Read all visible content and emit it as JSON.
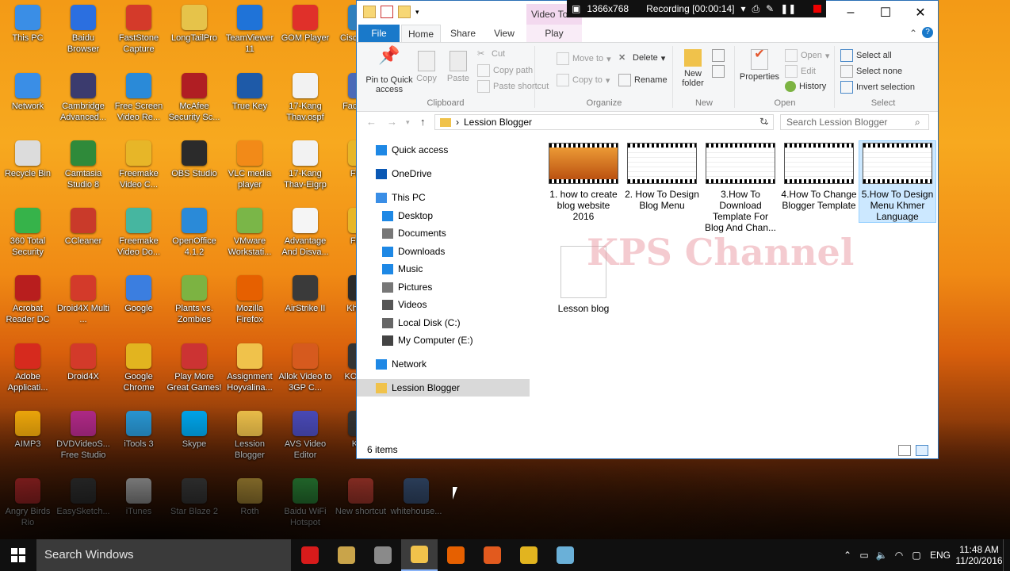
{
  "desktop": {
    "icons": [
      {
        "label": "This PC",
        "icon": "this-pc-icon",
        "color": "#3a8ee6"
      },
      {
        "label": "Baidu Browser",
        "icon": "baidu-browser-icon",
        "color": "#2b6fe0"
      },
      {
        "label": "FastStone Capture",
        "icon": "faststone-icon",
        "color": "#d43a2a"
      },
      {
        "label": "LongTailPro",
        "icon": "longtailpro-icon",
        "color": "#e6c34a"
      },
      {
        "label": "TeamViewer 11",
        "icon": "teamviewer-icon",
        "color": "#1f73d8"
      },
      {
        "label": "GOM Player",
        "icon": "gom-player-icon",
        "color": "#e0302a"
      },
      {
        "label": "Cisco Trac",
        "icon": "cisco-icon",
        "color": "#2f7fbd"
      },
      {
        "label": "Network",
        "icon": "network-icon",
        "color": "#3a8ee6"
      },
      {
        "label": "Cambridge Advanced...",
        "icon": "cambridge-icon",
        "color": "#3b3b6e"
      },
      {
        "label": "Free Screen Video Re...",
        "icon": "free-screen-icon",
        "color": "#2a8ad8"
      },
      {
        "label": "McAfee Security Sc...",
        "icon": "mcafee-icon",
        "color": "#b01e23"
      },
      {
        "label": "True Key",
        "icon": "true-key-icon",
        "color": "#1e5aa8"
      },
      {
        "label": "17-Kang Thav.ospf",
        "icon": "ospf-file-icon",
        "color": "#f2f2f2"
      },
      {
        "label": "Face Gar",
        "icon": "face-icon",
        "color": "#4a6ab8"
      },
      {
        "label": "Recycle Bin",
        "icon": "recycle-bin-icon",
        "color": "#dcdcdc"
      },
      {
        "label": "Camtasia Studio 8",
        "icon": "camtasia-icon",
        "color": "#2f8a3a"
      },
      {
        "label": "Freemake Video C...",
        "icon": "freemake-icon",
        "color": "#e7b628"
      },
      {
        "label": "OBS Studio",
        "icon": "obs-icon",
        "color": "#2b2b2b"
      },
      {
        "label": "VLC media player",
        "icon": "vlc-icon",
        "color": "#f28a18"
      },
      {
        "label": "17-Kang Thav-Eigrp",
        "icon": "eigrp-file-icon",
        "color": "#f2f2f2"
      },
      {
        "label": "Freer",
        "icon": "freer-icon",
        "color": "#e7b628"
      },
      {
        "label": "360 Total Security",
        "icon": "360-security-icon",
        "color": "#36b34a"
      },
      {
        "label": "CCleaner",
        "icon": "ccleaner-icon",
        "color": "#c93a2a"
      },
      {
        "label": "Freemake Video Do...",
        "icon": "freemake-download-icon",
        "color": "#46b6a0"
      },
      {
        "label": "OpenOffice 4.1.2",
        "icon": "openoffice-icon",
        "color": "#2a8ad8"
      },
      {
        "label": "VMware Workstati...",
        "icon": "vmware-icon",
        "color": "#7ab648"
      },
      {
        "label": "Advantage And Disva...",
        "icon": "document-icon",
        "color": "#f5f5f5"
      },
      {
        "label": "Freer",
        "icon": "freer2-icon",
        "color": "#e7b628"
      },
      {
        "label": "Acrobat Reader DC",
        "icon": "acrobat-icon",
        "color": "#b81e1e"
      },
      {
        "label": "Droid4X Multi ...",
        "icon": "droid4x-multi-icon",
        "color": "#d33a2a"
      },
      {
        "label": "Google",
        "icon": "google-icon",
        "color": "#3b7ee0"
      },
      {
        "label": "Plants vs. Zombies",
        "icon": "pvz-icon",
        "color": "#7cb342"
      },
      {
        "label": "Mozilla Firefox",
        "icon": "firefox-icon",
        "color": "#e66000"
      },
      {
        "label": "AirStrike II",
        "icon": "airstrike-icon",
        "color": "#3a3a3a"
      },
      {
        "label": "Kh Key",
        "icon": "khkey-icon",
        "color": "#2a2a2a"
      },
      {
        "label": "Adobe Applicati...",
        "icon": "adobe-icon",
        "color": "#d62a1e"
      },
      {
        "label": "Droid4X",
        "icon": "droid4x-icon",
        "color": "#d33a2a"
      },
      {
        "label": "Google Chrome",
        "icon": "chrome-icon",
        "color": "#e2b41f"
      },
      {
        "label": "Play More Great Games!",
        "icon": "popcap-icon",
        "color": "#c33"
      },
      {
        "label": "Assignment Hoyvalina...",
        "icon": "folder-icon",
        "color": "#f0c24b"
      },
      {
        "label": "Allok Video to 3GP C...",
        "icon": "allok-icon",
        "color": "#d65a1e"
      },
      {
        "label": "KOF Mu",
        "icon": "kof-icon",
        "color": "#333"
      },
      {
        "label": "AIMP3",
        "icon": "aimp-icon",
        "color": "#f1a90b"
      },
      {
        "label": "DVDVideoS... Free Studio",
        "icon": "dvdvideosoft-icon",
        "color": "#b42a8a"
      },
      {
        "label": "iTools 3",
        "icon": "itools-icon",
        "color": "#2a9ad8"
      },
      {
        "label": "Skype",
        "icon": "skype-icon",
        "color": "#00a9f0"
      },
      {
        "label": "Lession Blogger",
        "icon": "folder-icon",
        "color": "#f0c24b"
      },
      {
        "label": "AVS Video Editor",
        "icon": "avs-icon",
        "color": "#4a4ab8"
      },
      {
        "label": "KOF",
        "icon": "kof2-icon",
        "color": "#333"
      },
      {
        "label": "Angry Birds Rio",
        "icon": "angry-birds-icon",
        "color": "#d33"
      },
      {
        "label": "EasySketch...",
        "icon": "easysketch-icon",
        "color": "#444"
      },
      {
        "label": "iTunes",
        "icon": "itunes-icon",
        "color": "#eaeaea"
      },
      {
        "label": "Star Blaze 2",
        "icon": "starblaze-icon",
        "color": "#555"
      },
      {
        "label": "Roth",
        "icon": "folder-icon",
        "color": "#f0c24b"
      },
      {
        "label": "Baidu WiFi Hotspot",
        "icon": "baidu-wifi-icon",
        "color": "#3ab34a"
      },
      {
        "label": "New shortcut",
        "icon": "windows-shortcut-icon",
        "color": "#e74c3c"
      },
      {
        "label": "whitehouse...",
        "icon": "whitehouse-icon",
        "color": "#4a6a9a"
      }
    ]
  },
  "explorer": {
    "context_tab": "Video To",
    "recorder": {
      "resolution": "1366x768",
      "status": "Recording [00:00:14]"
    },
    "tabs": {
      "file": "File",
      "home": "Home",
      "share": "Share",
      "view": "View",
      "play": "Play"
    },
    "ribbon": {
      "clipboard": {
        "pin": "Pin to Quick access",
        "copy": "Copy",
        "paste": "Paste",
        "cut": "Cut",
        "copy_path": "Copy path",
        "paste_shortcut": "Paste shortcut",
        "group": "Clipboard"
      },
      "organize": {
        "move_to": "Move to",
        "copy_to": "Copy to",
        "delete": "Delete",
        "rename": "Rename",
        "group": "Organize"
      },
      "new": {
        "new_folder": "New folder",
        "group": "New"
      },
      "open": {
        "properties": "Properties",
        "open": "Open",
        "edit": "Edit",
        "history": "History",
        "group": "Open"
      },
      "select": {
        "select_all": "Select all",
        "select_none": "Select none",
        "invert": "Invert selection",
        "group": "Select"
      }
    },
    "address": {
      "path": "Lession Blogger",
      "search_placeholder": "Search Lession Blogger"
    },
    "nav": [
      {
        "label": "Quick access",
        "icon": "star-icon",
        "color": "#1e88e5"
      },
      {
        "label": "OneDrive",
        "icon": "onedrive-icon",
        "color": "#0a58b4"
      },
      {
        "label": "This PC",
        "icon": "this-pc-icon",
        "color": "#3a8ee6"
      },
      {
        "label": "Desktop",
        "icon": "desktop-icon",
        "color": "#1e88e5"
      },
      {
        "label": "Documents",
        "icon": "documents-icon",
        "color": "#777"
      },
      {
        "label": "Downloads",
        "icon": "downloads-icon",
        "color": "#1e88e5"
      },
      {
        "label": "Music",
        "icon": "music-icon",
        "color": "#1e88e5"
      },
      {
        "label": "Pictures",
        "icon": "pictures-icon",
        "color": "#777"
      },
      {
        "label": "Videos",
        "icon": "videos-icon",
        "color": "#555"
      },
      {
        "label": "Local Disk (C:)",
        "icon": "local-disk-icon",
        "color": "#666"
      },
      {
        "label": "My Computer (E:)",
        "icon": "drive-icon",
        "color": "#444"
      },
      {
        "label": "Network",
        "icon": "network-icon",
        "color": "#1e88e5"
      },
      {
        "label": "Lession Blogger",
        "icon": "folder-icon",
        "color": "#f0c24b"
      }
    ],
    "files": [
      {
        "label": "1. how to create blog website 2016",
        "icon": "video-thumbnail-icon"
      },
      {
        "label": "2. How To Design Blog Menu",
        "icon": "video-thumbnail-icon"
      },
      {
        "label": "3.How To Download Template For Blog And Chan...",
        "icon": "video-thumbnail-icon"
      },
      {
        "label": "4.How To Change Blogger Template",
        "icon": "video-thumbnail-icon"
      },
      {
        "label": "5.How To Design Menu Khmer Language",
        "icon": "video-thumbnail-icon"
      },
      {
        "label": "Lesson blog",
        "icon": "document-icon"
      }
    ],
    "status": "6 items",
    "watermark": "KPS Channel"
  },
  "taskbar": {
    "search_placeholder": "Search Windows",
    "apps": [
      {
        "icon": "recorder-icon",
        "color": "#d81b1b"
      },
      {
        "icon": "winrar-icon",
        "color": "#c9a44a"
      },
      {
        "icon": "snipping-icon",
        "color": "#8a8a8a"
      },
      {
        "icon": "file-explorer-icon",
        "color": "#f0c24b"
      },
      {
        "icon": "firefox-icon",
        "color": "#e66000"
      },
      {
        "icon": "media-icon",
        "color": "#e25a1e"
      },
      {
        "icon": "chrome-icon",
        "color": "#e2b41f"
      },
      {
        "icon": "notepad-icon",
        "color": "#6ab0d8"
      }
    ],
    "language": "ENG",
    "time": "11:48 AM",
    "date": "11/20/2016"
  }
}
